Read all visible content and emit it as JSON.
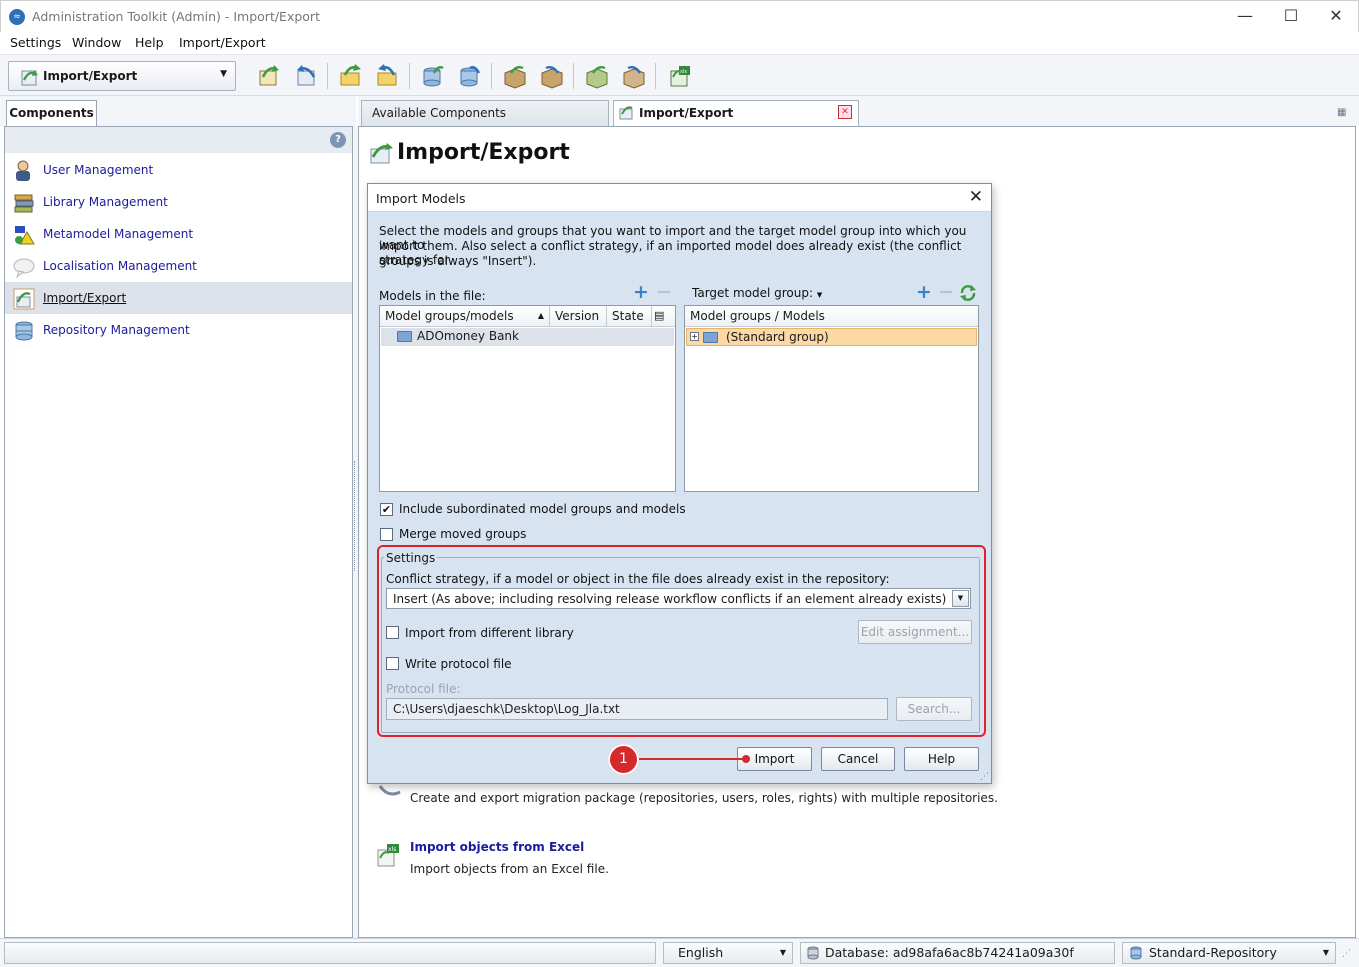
{
  "window": {
    "title": "Administration Toolkit (Admin) - Import/Export",
    "minimize": "—",
    "maximize": "☐",
    "close": "✕"
  },
  "menubar": [
    "Settings",
    "Window",
    "Help",
    "Import/Export"
  ],
  "toolbar": {
    "mode_combo": "Import/Export"
  },
  "left": {
    "tab": "Components",
    "items": [
      {
        "label": "User Management"
      },
      {
        "label": "Library Management"
      },
      {
        "label": "Metamodel Management"
      },
      {
        "label": "Localisation Management"
      },
      {
        "label": "Import/Export"
      },
      {
        "label": "Repository Management"
      }
    ]
  },
  "tabs": {
    "available": "Available Components",
    "active": "Import/Export"
  },
  "page": {
    "title": "Import/Export",
    "sections": [
      {
        "desc": "Create and export migration package (repositories, users, roles, rights) with multiple repositories."
      },
      {
        "title": "Import objects from Excel",
        "desc": "Import objects from an Excel file."
      }
    ]
  },
  "dialog": {
    "title": "Import Models",
    "intro_line1": "Select the models and groups that you want to import and the target model group into which you want to",
    "intro_line2": "import them. Also select a conflict strategy, if an imported model does already exist (the conflict strategy for",
    "intro_line3": "groups is always \"Insert\").",
    "models_label": "Models in the file:",
    "models_columns": [
      "Model groups/models",
      "Version",
      "State"
    ],
    "models_rows": [
      "ADOmoney Bank"
    ],
    "target_label": "Target model group:",
    "target_columns": [
      "Model groups / Models"
    ],
    "target_rows": [
      "(Standard group)"
    ],
    "include_subordinated": "Include subordinated model groups and models",
    "merge_moved": "Merge moved groups",
    "settings_legend": "Settings",
    "conflict_label": "Conflict strategy, if a model or object in the file does already exist in the repository:",
    "conflict_value": "Insert (As above; including resolving release workflow conflicts if an element already exists)",
    "import_diff_lib": "Import from different library",
    "edit_assignment": "Edit assignment...",
    "write_protocol": "Write protocol file",
    "protocol_label": "Protocol file:",
    "protocol_path": "C:\\Users\\djaeschk\\Desktop\\Log_Jla.txt",
    "search": "Search...",
    "import": "Import",
    "cancel": "Cancel",
    "help": "Help",
    "close_glyph": "✕"
  },
  "annotation": {
    "marker": "1",
    "color": "#d42a2e"
  },
  "statusbar": {
    "language": "English",
    "database": "Database: ad98afa6ac8b74241a09a30f",
    "repository": "Standard-Repository"
  },
  "colors": {
    "dialog_bg": "#d8e3f1",
    "link_blue": "#1b1b9e",
    "highlight_row": "#fbd8a4",
    "accent_red": "#e0222a"
  }
}
